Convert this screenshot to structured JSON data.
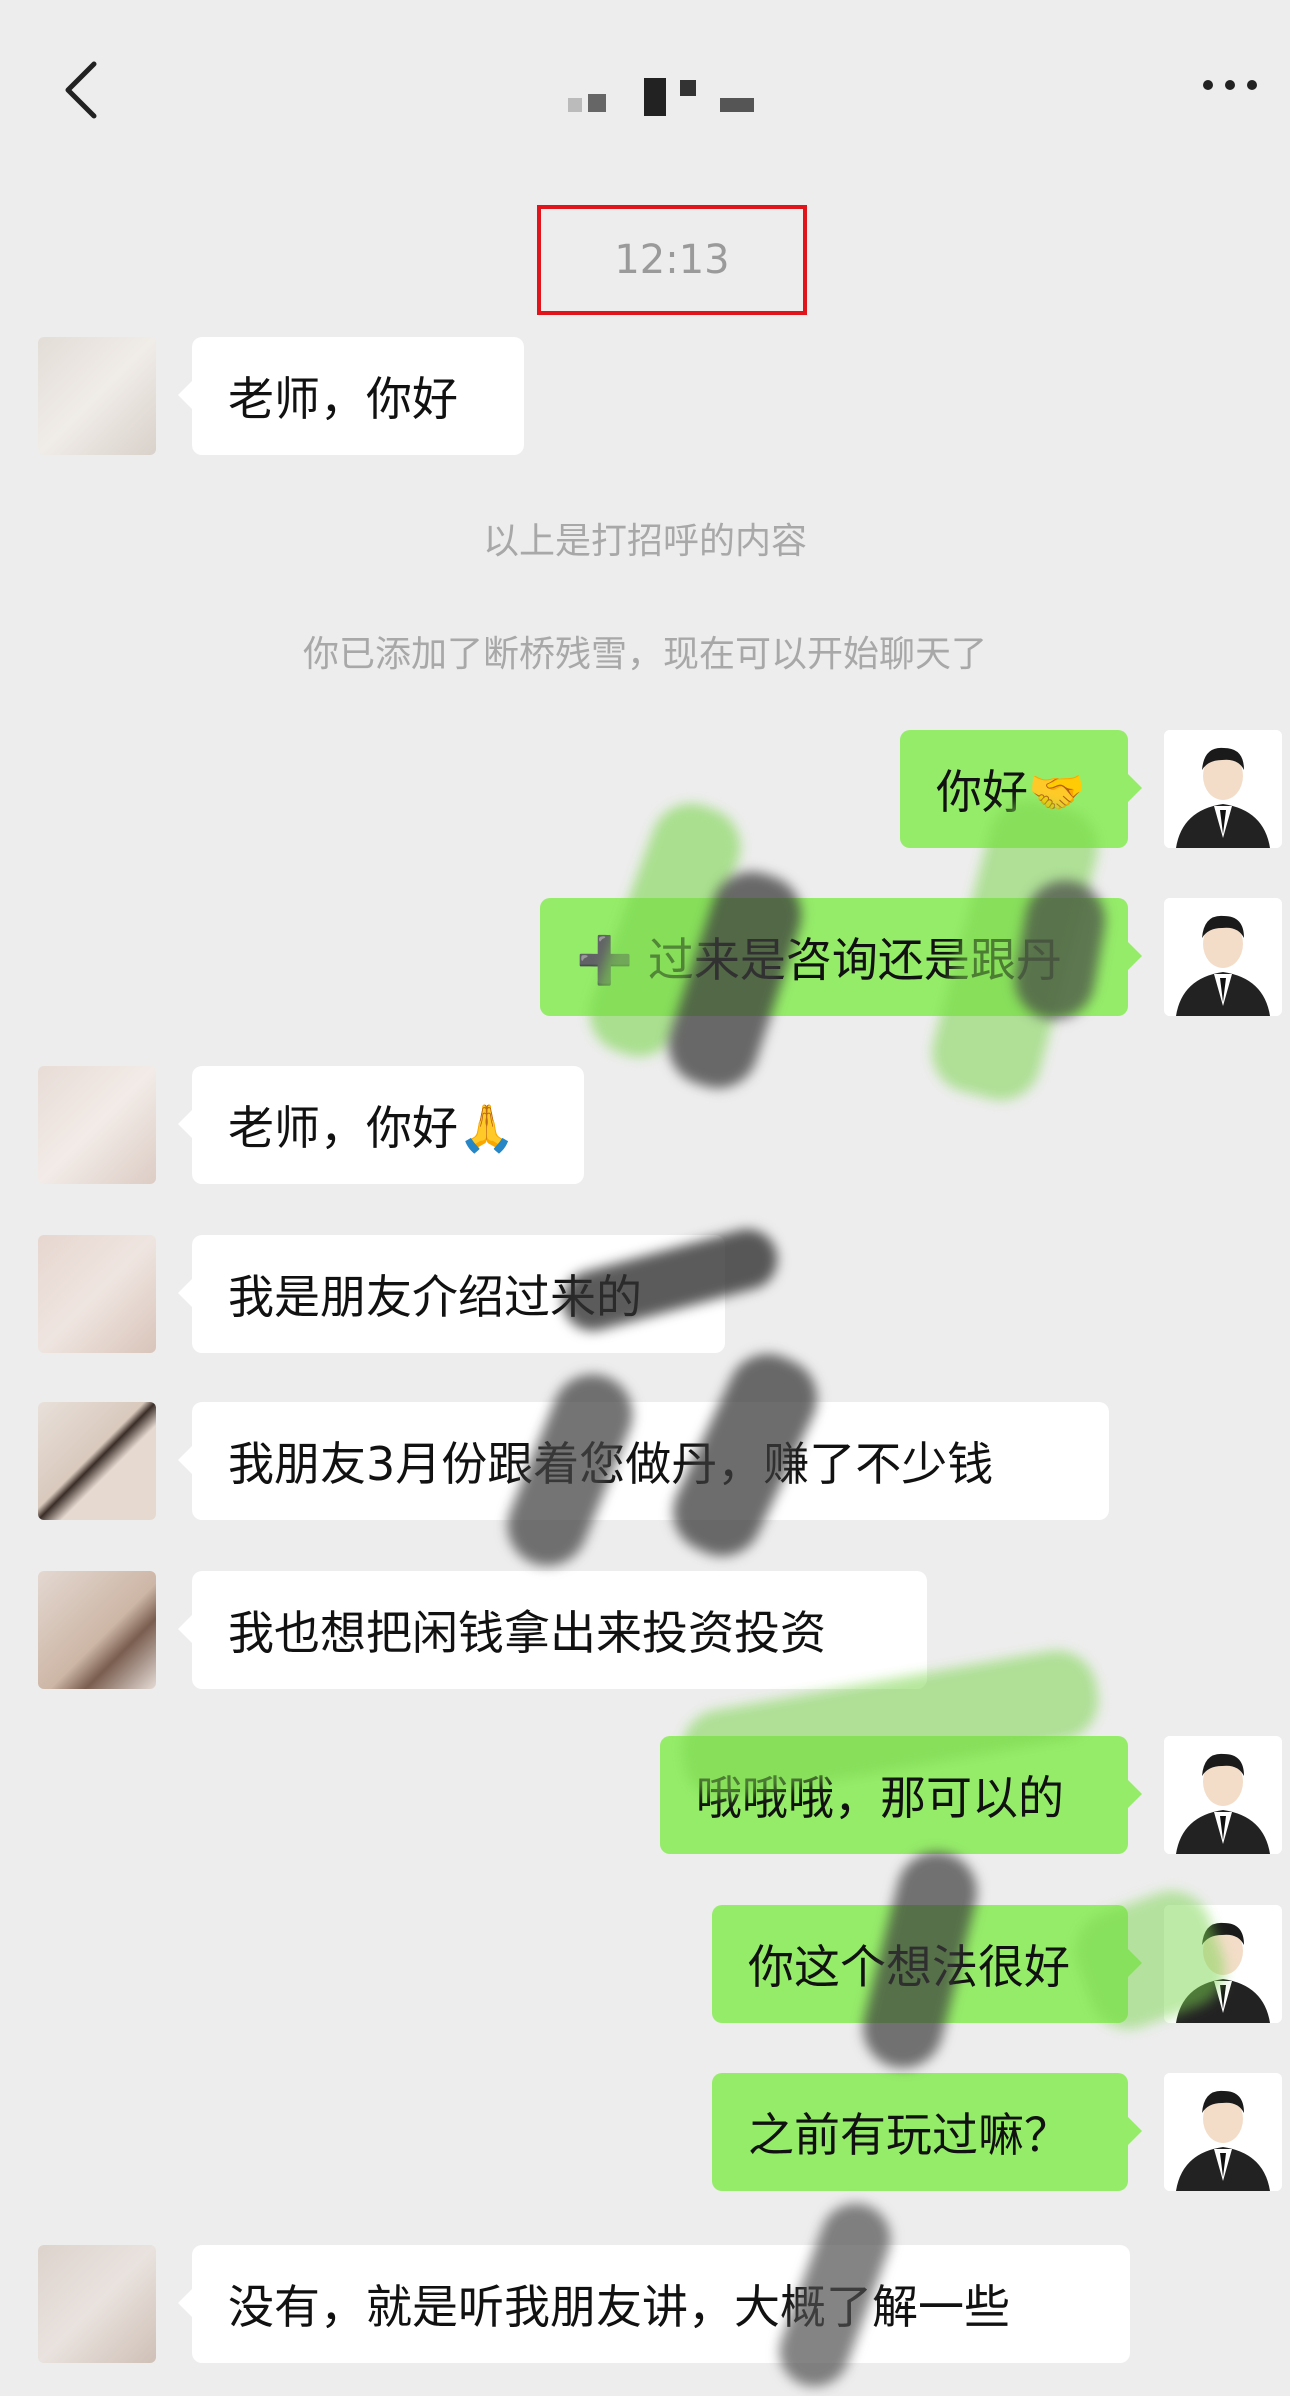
{
  "header": {
    "back_icon": "chevron-left-icon",
    "more_icon": "more-horizontal-icon"
  },
  "timestamp": "12:13",
  "system_messages": [
    "以上是打招呼的内容",
    "你已添加了断桥残雪，现在可以开始聊天了"
  ],
  "messages": [
    {
      "side": "in",
      "text": "老师，你好"
    },
    {
      "side": "out",
      "text": "你好🤝"
    },
    {
      "side": "out",
      "text": "➕ 过来是咨询还是跟丹"
    },
    {
      "side": "in",
      "text": "老师，你好🙏"
    },
    {
      "side": "in",
      "text": "我是朋友介绍过来的"
    },
    {
      "side": "in",
      "text": "我朋友3月份跟着您做丹，赚了不少钱"
    },
    {
      "side": "in",
      "text": "我也想把闲钱拿出来投资投资"
    },
    {
      "side": "out",
      "text": "哦哦哦，那可以的"
    },
    {
      "side": "out",
      "text": "你这个想法很好"
    },
    {
      "side": "out",
      "text": "之前有玩过嘛？"
    },
    {
      "side": "in",
      "text": "没有，就是听我朋友讲，大概了解一些"
    }
  ],
  "colors": {
    "background": "#ededed",
    "incoming_bubble": "#ffffff",
    "outgoing_bubble": "#95ec69",
    "highlight_box": "#e0141a"
  }
}
